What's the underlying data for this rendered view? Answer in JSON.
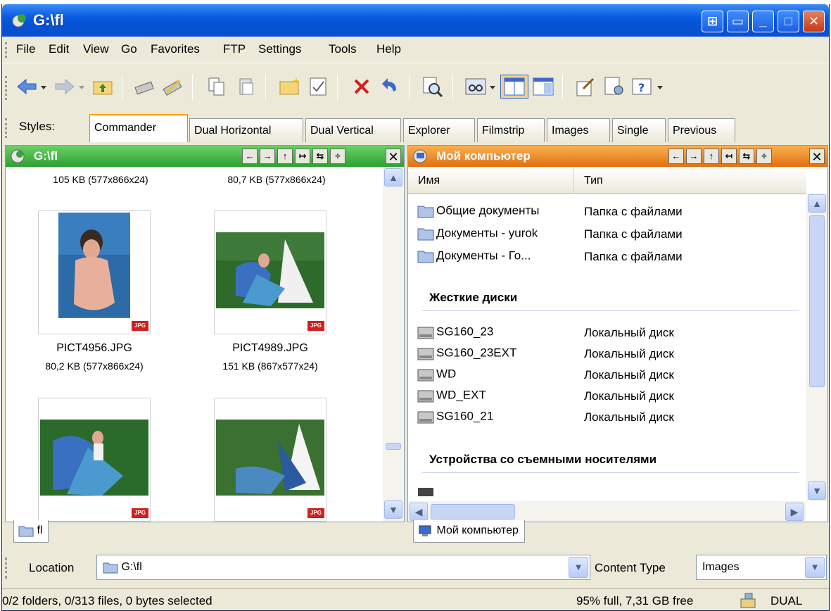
{
  "window": {
    "title": "G:\\fl"
  },
  "menu": [
    "File",
    "Edit",
    "View",
    "Go",
    "Favorites",
    "FTP",
    "Settings",
    "Tools",
    "Help"
  ],
  "styles": {
    "label": "Styles:",
    "tabs": [
      "Commander",
      "Dual Horizontal",
      "Dual Vertical",
      "Explorer",
      "Filmstrip",
      "Images",
      "Single",
      "Previous"
    ],
    "active": "Commander"
  },
  "left_pane": {
    "title": "G:\\fl",
    "top_sizes": [
      "105 KB (577x866x24)",
      "80,7 KB (577x866x24)"
    ],
    "thumbs": [
      {
        "name": "PICT4956.JPG",
        "size": "80,2 KB (577x866x24)"
      },
      {
        "name": "PICT4989.JPG",
        "size": "151 KB (867x577x24)"
      }
    ],
    "badge": "JPG",
    "tab": "fl"
  },
  "right_pane": {
    "title": "Мой компьютер",
    "columns": [
      "Имя",
      "Тип"
    ],
    "folders": [
      {
        "name": "Общие документы",
        "type": "Папка с файлами"
      },
      {
        "name": "Документы - yurok",
        "type": "Папка с файлами"
      },
      {
        "name": "Документы - Го...",
        "type": "Папка с файлами"
      }
    ],
    "group_disks": "Жесткие диски",
    "disks": [
      {
        "name": "SG160_23",
        "type": "Локальный диск"
      },
      {
        "name": "SG160_23EXT",
        "type": "Локальный диск"
      },
      {
        "name": "WD",
        "type": "Локальный диск"
      },
      {
        "name": "WD_EXT",
        "type": "Локальный диск"
      },
      {
        "name": "SG160_21",
        "type": "Локальный диск"
      }
    ],
    "group_removable": "Устройства со съемными носителями",
    "tab": "Мой компьютер"
  },
  "location": {
    "label": "Location",
    "value": "G:\\fl",
    "content_type_label": "Content Type",
    "content_type_value": "Images"
  },
  "status": {
    "left": "0/2 folders, 0/313 files, 0 bytes selected",
    "right": "95% full, 7,31 GB free",
    "mode": "DUAL"
  },
  "colors": {
    "title_blue": "#0a5ae0",
    "left_header": "#3cb83c",
    "right_header": "#f08c1c",
    "selection": "#316ac5"
  }
}
